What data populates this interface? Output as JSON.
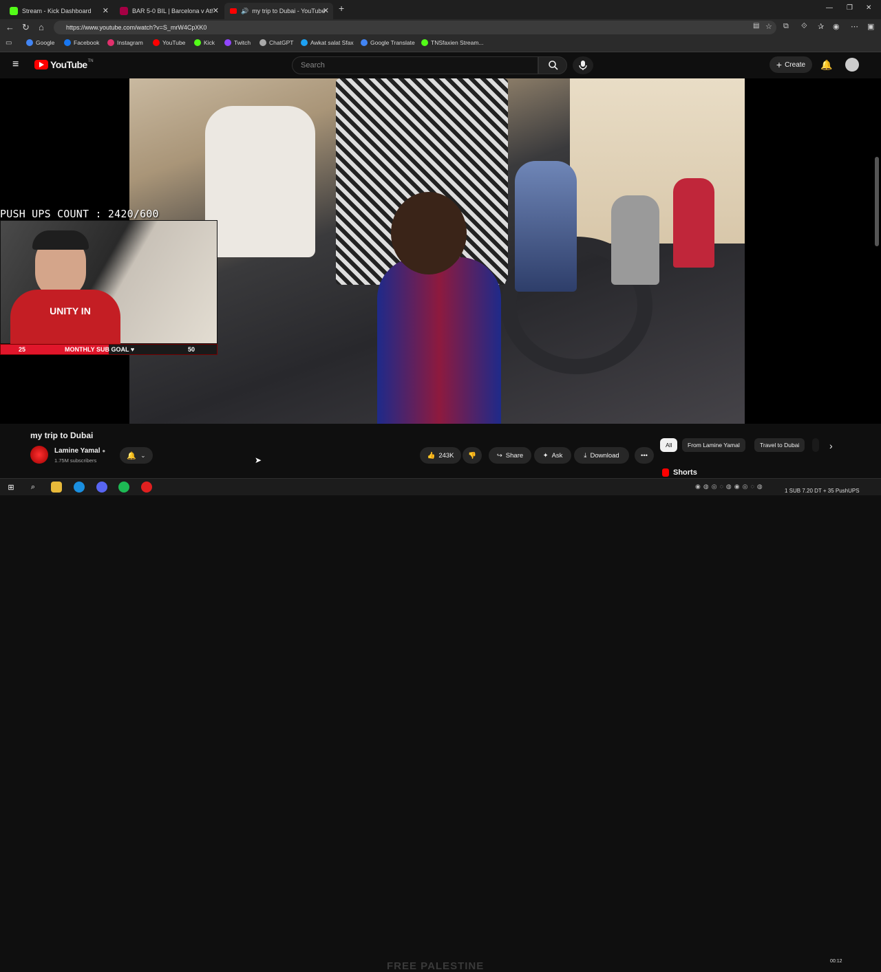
{
  "browser": {
    "tabs": [
      {
        "label": "Stream - Kick Dashboard",
        "color": "#53fc18"
      },
      {
        "label": "BAR 5-0 BIL | Barcelona v Ath Bilb...",
        "color": "#a50044"
      },
      {
        "label": "my trip to Dubai - YouTube",
        "color": "#ff0000"
      }
    ],
    "new_tab": "+",
    "url": "https://www.youtube.com/watch?v=S_mrW4CpXK0",
    "bookmarks": [
      {
        "label": "Google",
        "color": "#4285f4"
      },
      {
        "label": "Facebook",
        "color": "#1877f2"
      },
      {
        "label": "Instagram",
        "color": "#e1306c"
      },
      {
        "label": "YouTube",
        "color": "#ff0000"
      },
      {
        "label": "Kick",
        "color": "#53fc18"
      },
      {
        "label": "Twitch",
        "color": "#9146ff"
      },
      {
        "label": "ChatGPT",
        "color": "#aaaaaa"
      },
      {
        "label": "Awkat salat Sfax",
        "color": "#1da1f2"
      },
      {
        "label": "Google Translate",
        "color": "#4285f4"
      },
      {
        "label": "TNSfaxien Stream...",
        "color": "#53fc18"
      }
    ]
  },
  "youtube": {
    "logo": "YouTube",
    "logo_tm": "TN",
    "search_placeholder": "Search",
    "create_label": "Create",
    "video": {
      "title": "my trip to Dubai",
      "channel": "Lamine Yamal",
      "subscribers": "1.75M subscribers",
      "likes": "243K",
      "share": "Share",
      "ask": "Ask",
      "download": "Download"
    },
    "chips": [
      {
        "label": "All",
        "active": true
      },
      {
        "label": "From Lamine Yamal",
        "active": false
      },
      {
        "label": "Travel to Dubai",
        "active": false
      }
    ],
    "shorts_label": "Shorts"
  },
  "overlay": {
    "pushups": "PUSH UPS COUNT : 2420/600",
    "subgoal_current": "25",
    "subgoal_label": "MONTHLY SUB GOAL ♥",
    "subgoal_target": "50",
    "subgoal_progress": 0.5,
    "shirt_text": "UNITY IN"
  },
  "taskbar": {
    "bottom_text": "FREE PALESTINE",
    "time": "00:12",
    "ticker": "1 SUB 7.20 DT + 35 PushUPS"
  }
}
